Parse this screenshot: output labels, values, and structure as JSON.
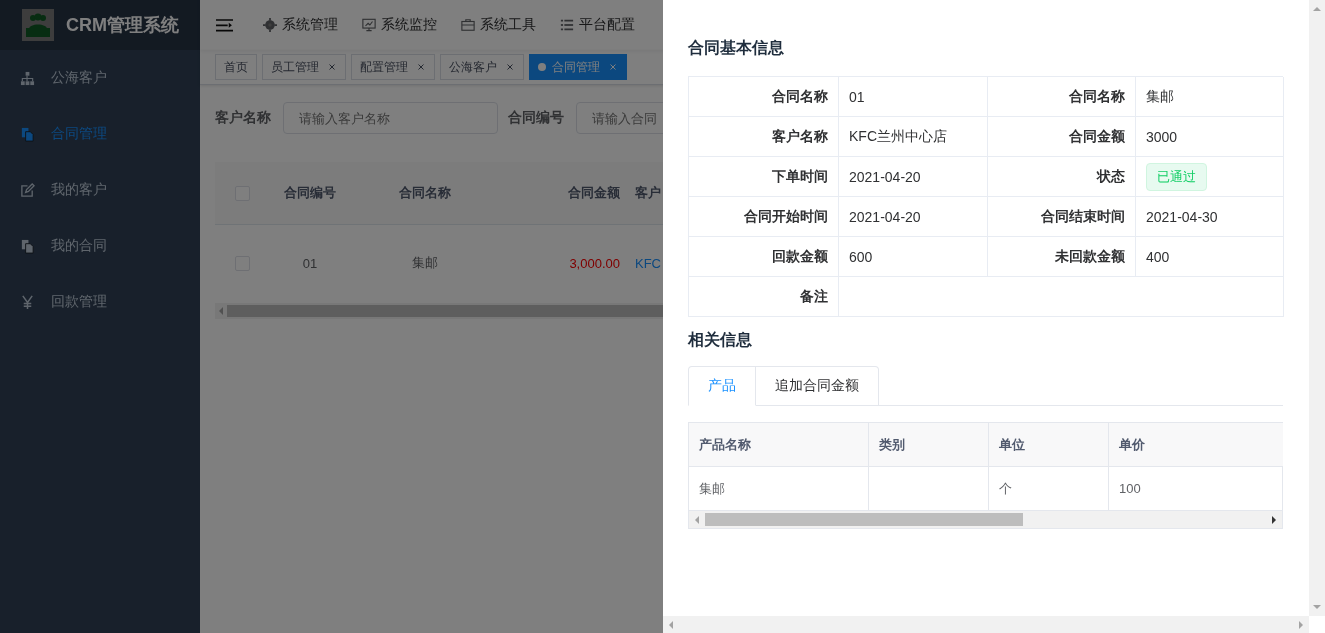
{
  "sidebar": {
    "logo_text": "CRM管理系统",
    "items": [
      {
        "label": "公海客户",
        "selected": false
      },
      {
        "label": "合同管理",
        "selected": true
      },
      {
        "label": "我的客户",
        "selected": false
      },
      {
        "label": "我的合同",
        "selected": false
      },
      {
        "label": "回款管理",
        "selected": false
      }
    ]
  },
  "topbar": {
    "menu": [
      {
        "label": "系统管理"
      },
      {
        "label": "系统监控"
      },
      {
        "label": "系统工具"
      },
      {
        "label": "平台配置"
      }
    ]
  },
  "tags": [
    {
      "label": "首页",
      "closable": false,
      "selected": false
    },
    {
      "label": "员工管理",
      "closable": true,
      "selected": false
    },
    {
      "label": "配置管理",
      "closable": true,
      "selected": false
    },
    {
      "label": "公海客户",
      "closable": true,
      "selected": false
    },
    {
      "label": "合同管理",
      "closable": true,
      "selected": true
    }
  ],
  "search": {
    "fields": [
      {
        "label": "客户名称",
        "placeholder": "请输入客户名称"
      },
      {
        "label": "合同编号",
        "placeholder": "请输入合同"
      }
    ]
  },
  "table": {
    "columns": [
      "合同编号",
      "合同名称",
      "合同金额",
      "客户"
    ],
    "header_checked": false,
    "rows": [
      {
        "checked": false,
        "cells": [
          {
            "text": "01",
            "kind": "plain"
          },
          {
            "text": "集邮",
            "kind": "plain"
          },
          {
            "text": "3,000.00",
            "kind": "money"
          },
          {
            "text": "KFC",
            "kind": "link"
          }
        ]
      }
    ]
  },
  "drawer": {
    "title": "合同基本信息",
    "details": [
      [
        {
          "label": "合同名称",
          "value": "01",
          "kind": "text"
        },
        {
          "label": "合同名称",
          "value": "集邮",
          "kind": "text"
        }
      ],
      [
        {
          "label": "客户名称",
          "value": "KFC兰州中心店",
          "kind": "text"
        },
        {
          "label": "合同金额",
          "value": "3000",
          "kind": "text"
        }
      ],
      [
        {
          "label": "下单时间",
          "value": "2021-04-20",
          "kind": "text"
        },
        {
          "label": "状态",
          "value": "已通过",
          "kind": "tag"
        }
      ],
      [
        {
          "label": "合同开始时间",
          "value": "2021-04-20",
          "kind": "text"
        },
        {
          "label": "合同结束时间",
          "value": "2021-04-30",
          "kind": "text"
        }
      ],
      [
        {
          "label": "回款金额",
          "value": "600",
          "kind": "text"
        },
        {
          "label": "未回款金额",
          "value": "400",
          "kind": "text"
        }
      ],
      [
        {
          "label": "备注",
          "kind": "wide"
        }
      ]
    ],
    "related_title": "相关信息",
    "tabs": [
      {
        "label": "产品",
        "selected": true
      },
      {
        "label": "追加合同金额",
        "selected": false
      }
    ],
    "products": {
      "columns": [
        "产品名称",
        "类别",
        "单位",
        "单价"
      ],
      "rows": [
        {
          "cells": [
            "集邮",
            null,
            "个",
            "100"
          ]
        }
      ]
    }
  }
}
